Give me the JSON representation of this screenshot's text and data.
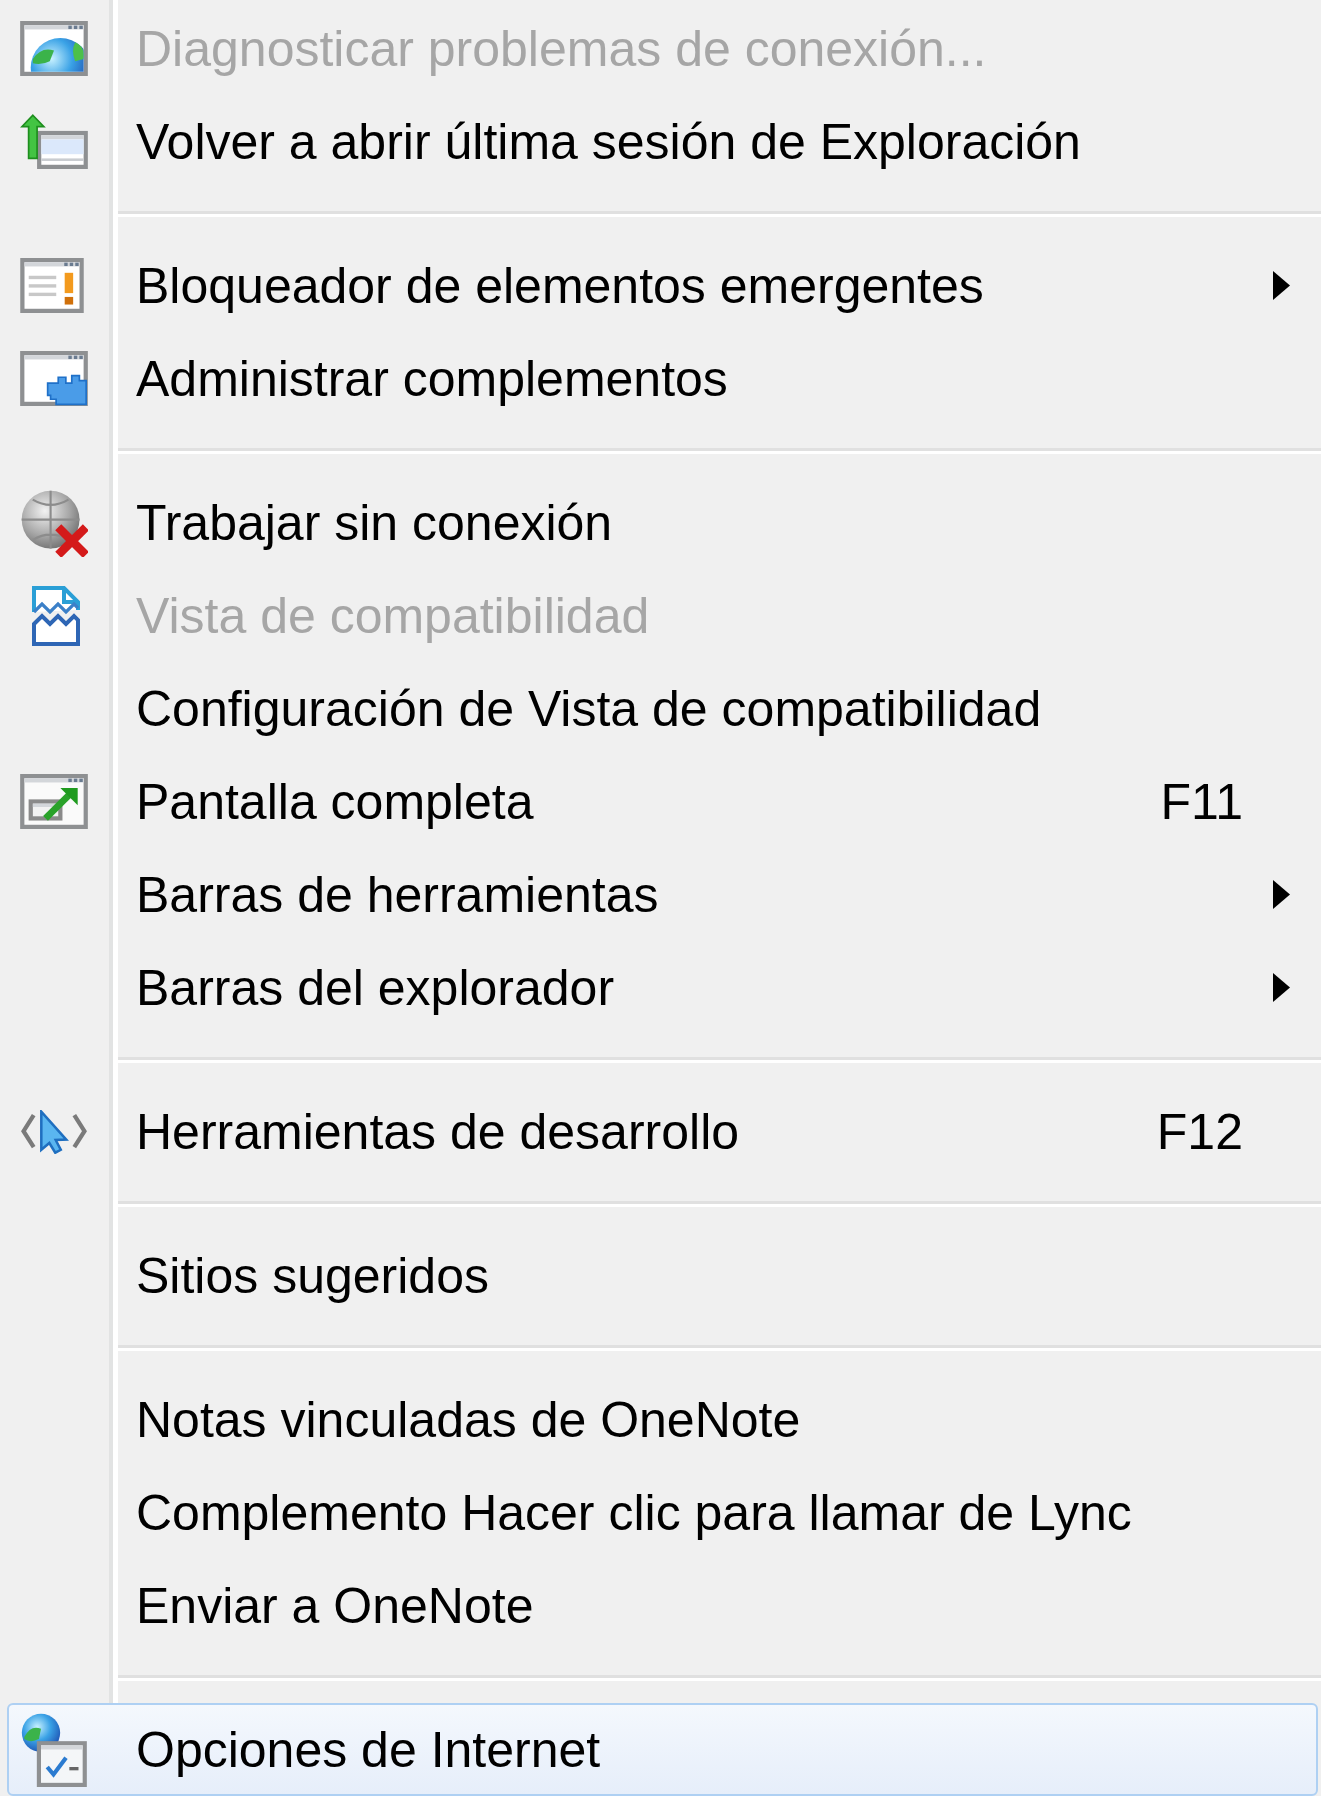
{
  "menu": {
    "sections": [
      {
        "items": [
          {
            "label": "Diagnosticar problemas de conexión...",
            "disabled": true,
            "submenu": false,
            "selected": false
          },
          {
            "label": "Volver a abrir última sesión de Exploración",
            "disabled": false,
            "submenu": false,
            "selected": false
          }
        ]
      },
      {
        "items": [
          {
            "label": "Bloqueador de elementos emergentes",
            "disabled": false,
            "submenu": true,
            "selected": false
          },
          {
            "label": "Administrar complementos",
            "disabled": false,
            "submenu": false,
            "selected": false
          }
        ]
      },
      {
        "items": [
          {
            "label": "Trabajar sin conexión",
            "disabled": false,
            "submenu": false,
            "selected": false
          },
          {
            "label": "Vista de compatibilidad",
            "disabled": true,
            "submenu": false,
            "selected": false
          },
          {
            "label": "Configuración de Vista de compatibilidad",
            "disabled": false,
            "submenu": false,
            "selected": false
          },
          {
            "label": "Pantalla completa",
            "shortcut": "F11",
            "disabled": false,
            "submenu": false,
            "selected": false
          },
          {
            "label": "Barras de herramientas",
            "disabled": false,
            "submenu": true,
            "selected": false
          },
          {
            "label": "Barras del explorador",
            "disabled": false,
            "submenu": true,
            "selected": false
          }
        ]
      },
      {
        "items": [
          {
            "label": "Herramientas de desarrollo",
            "shortcut": "F12",
            "disabled": false,
            "submenu": false,
            "selected": false
          }
        ]
      },
      {
        "items": [
          {
            "label": "Sitios sugeridos",
            "disabled": false,
            "submenu": false,
            "selected": false
          }
        ]
      },
      {
        "items": [
          {
            "label": "Notas vinculadas de OneNote",
            "disabled": false,
            "submenu": false,
            "selected": false
          },
          {
            "label": "Complemento Hacer clic para llamar de Lync",
            "disabled": false,
            "submenu": false,
            "selected": false
          },
          {
            "label": "Enviar a OneNote",
            "disabled": false,
            "submenu": false,
            "selected": false
          }
        ]
      },
      {
        "items": [
          {
            "label": "Opciones de Internet",
            "disabled": false,
            "submenu": false,
            "selected": true
          }
        ]
      }
    ]
  }
}
